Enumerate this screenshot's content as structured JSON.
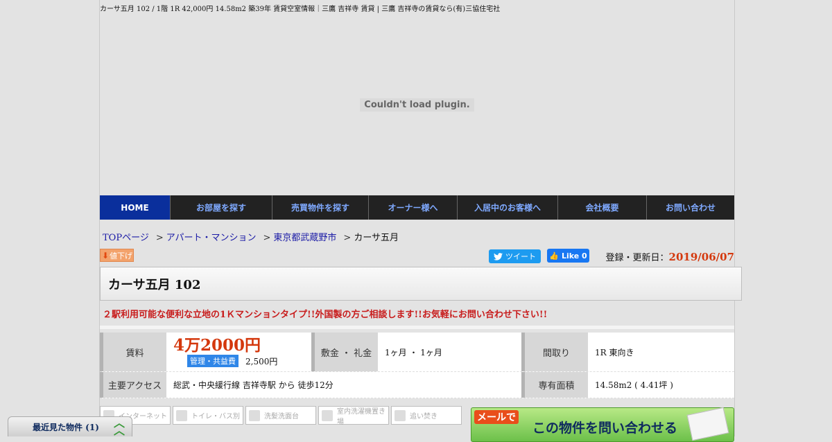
{
  "page_title": "カーサ五月 102 / 1階 1R 42,000円 14.58m2 築39年 賃貸空室情報｜三鷹 吉祥寺 賃貸 | 三鷹 吉祥寺の賃貸なら(有)三協住宅社",
  "plugin_message": "Couldn't load plugin.",
  "nav": [
    {
      "label": "HOME"
    },
    {
      "label": "お部屋を探す"
    },
    {
      "label": "売買物件を探す"
    },
    {
      "label": "オーナー様へ"
    },
    {
      "label": "入居中のお客様へ"
    },
    {
      "label": "会社概要"
    },
    {
      "label": "お問い合わせ"
    }
  ],
  "breadcrumb": {
    "top": "TOPページ",
    "category": "アパート・マンション",
    "area": "東京都武蔵野市",
    "current": "カーサ五月"
  },
  "price_down_label": "値下げ",
  "share": {
    "tweet": "ツイート",
    "like": "Like 0"
  },
  "updated": {
    "label": "登録・更新日：",
    "date": "2019/06/07"
  },
  "property_name": "カーサ五月  102",
  "catch_copy": "２駅利用可能な便利な立地の1Ｋマンションタイプ!!外国製の方ご相談します!!お気軽にお問い合わせ下さい!!",
  "details": {
    "rent_label": "賃料",
    "rent_value": "4万2000円",
    "fee_label": "管理・共益費",
    "fee_value": "2,500円",
    "deposit_label": "敷金 ・ 礼金",
    "deposit_value": "1ヶ月 ・ 1ヶ月",
    "layout_label": "間取り",
    "layout_value": "1R 東向き",
    "access_label": "主要アクセス",
    "access_value": "総武・中央緩行線 吉祥寺駅 から 徒歩12分",
    "area_label": "専有面積",
    "area_value": "14.58m2 ( 4.41坪 )"
  },
  "features": [
    "インターネット",
    "トイレ・バス別",
    "洗髪洗面台",
    "室内洗濯機置き場",
    "追い焚き"
  ],
  "contact": {
    "badge": "メールで",
    "label": "この物件を問い合わせる"
  },
  "recent": {
    "label": "最近見た物件 (1)"
  },
  "colors": {
    "nav_bg": "#222222",
    "nav_home": "#0a2f9c",
    "price": "#d4380d",
    "accent_blue": "#2f86e8"
  }
}
